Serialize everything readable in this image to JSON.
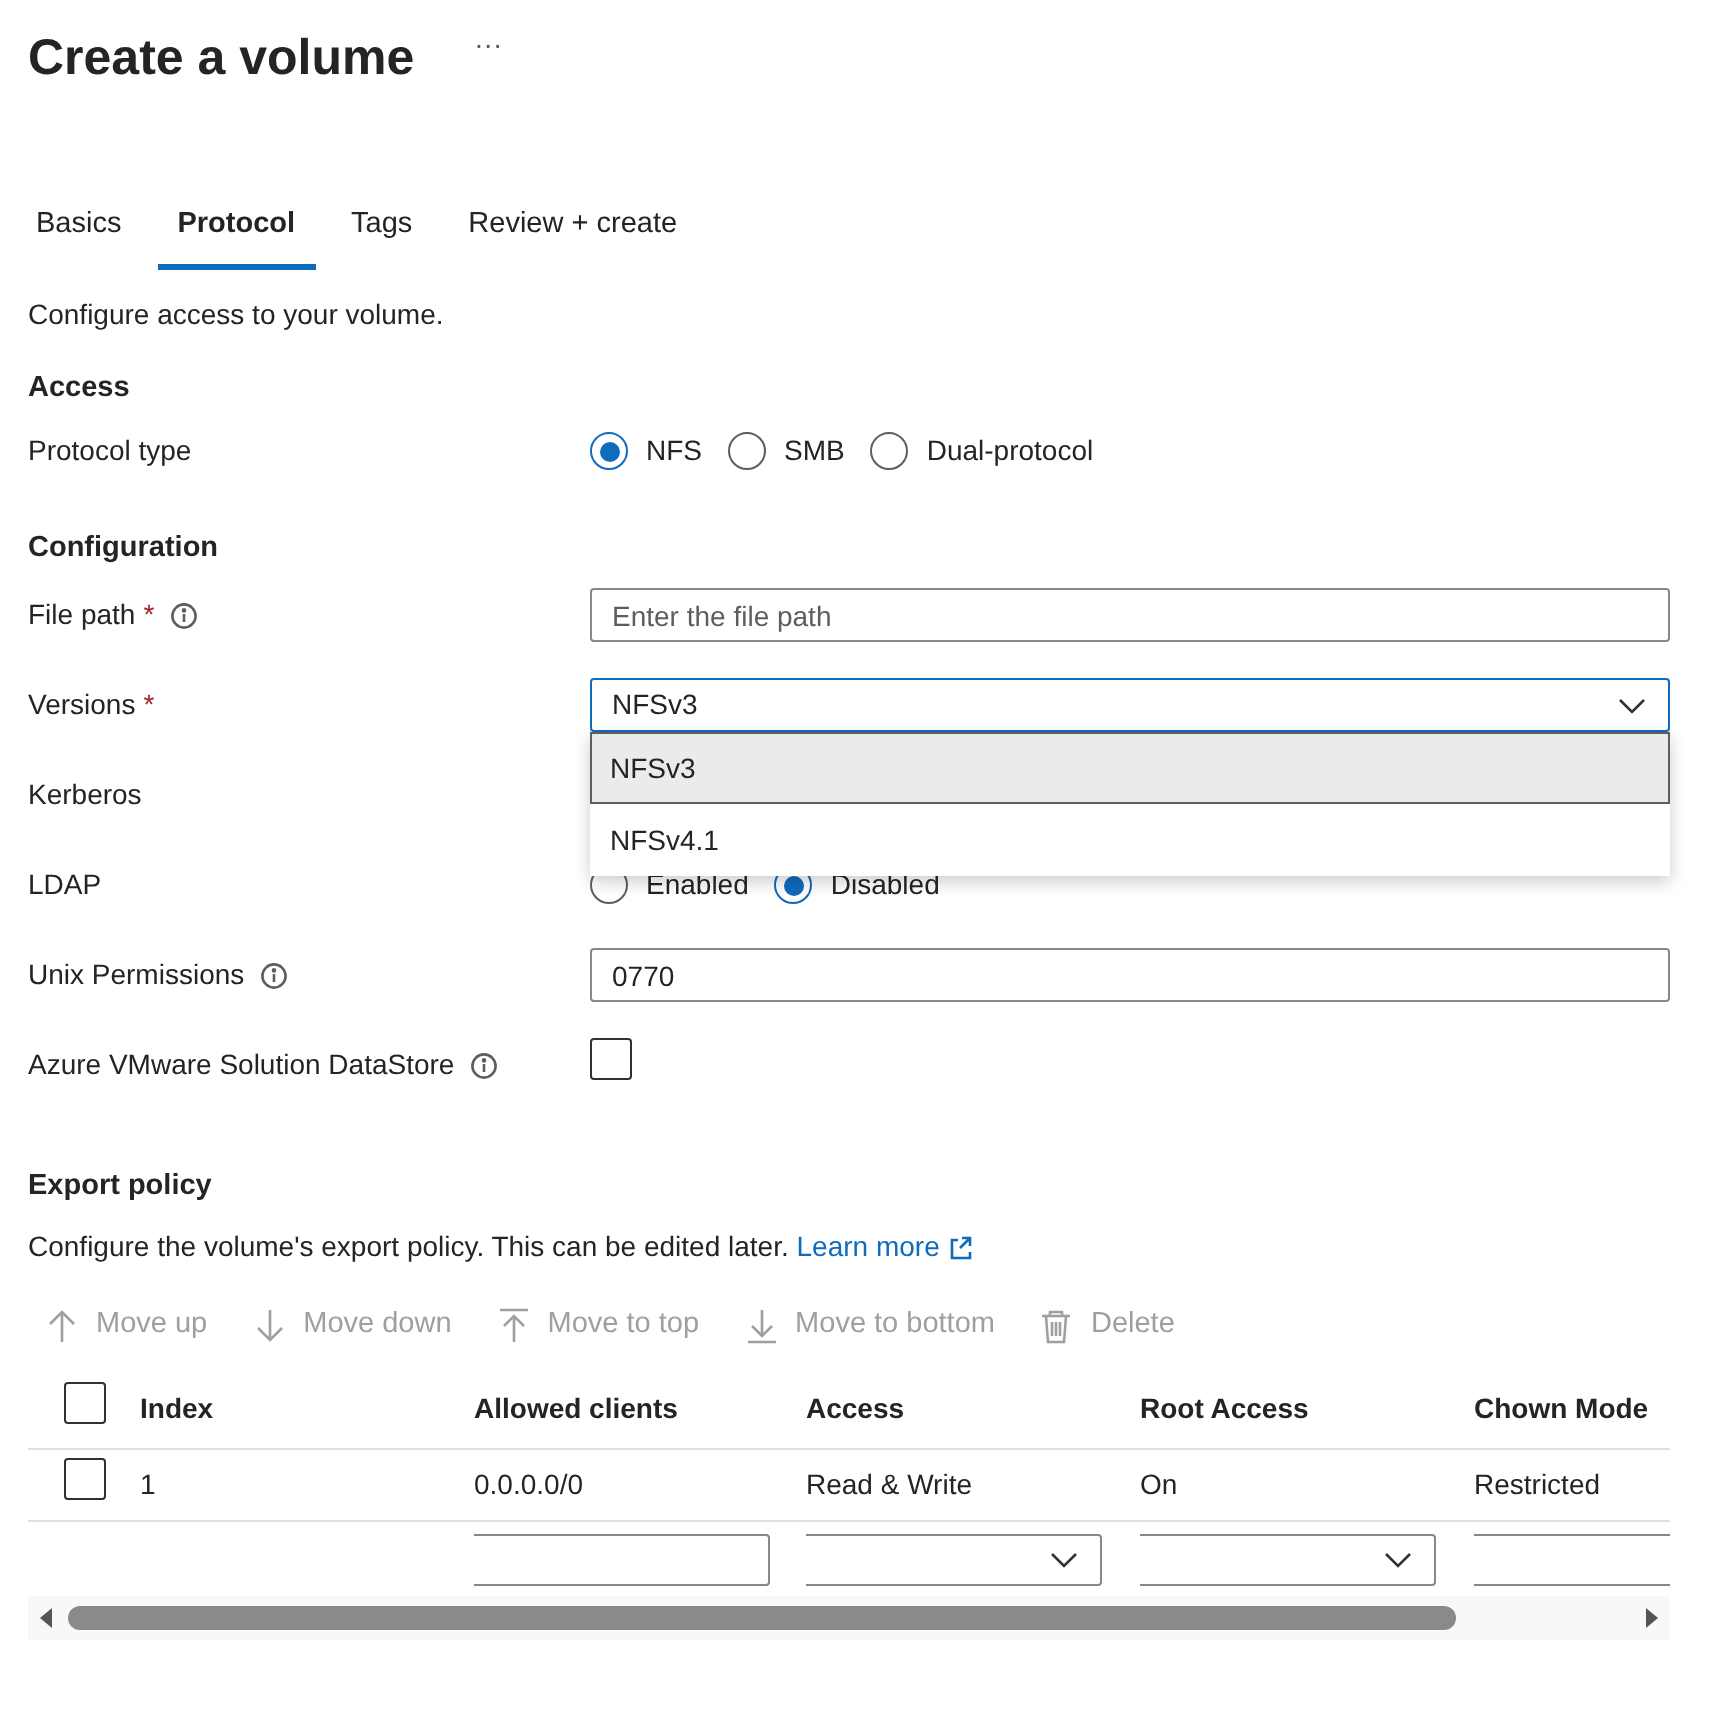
{
  "title": "Create a volume",
  "more": "···",
  "tabs": [
    {
      "label": "Basics",
      "selected": false
    },
    {
      "label": "Protocol",
      "selected": true
    },
    {
      "label": "Tags",
      "selected": false
    },
    {
      "label": "Review + create",
      "selected": false
    }
  ],
  "intro": "Configure access to your volume.",
  "access": {
    "heading": "Access",
    "label": "Protocol type",
    "options": [
      {
        "label": "NFS",
        "selected": true
      },
      {
        "label": "SMB",
        "selected": false
      },
      {
        "label": "Dual-protocol",
        "selected": false
      }
    ]
  },
  "configuration": {
    "heading": "Configuration",
    "fields": [
      {
        "kind": "text",
        "label": "File path",
        "required_mark": "*",
        "info": true,
        "placeholder": "Enter the file path"
      },
      {
        "kind": "select",
        "label": "Versions",
        "required_mark": "*",
        "value": "NFSv3",
        "expanded": true,
        "options": [
          {
            "label": "NFSv3",
            "selected": true
          },
          {
            "label": "NFSv4.1",
            "selected": false
          }
        ]
      },
      {
        "kind": "covered",
        "label": "Kerberos"
      },
      {
        "kind": "radio",
        "label": "LDAP",
        "options": [
          {
            "label": "Enabled",
            "selected": false
          },
          {
            "label": "Disabled",
            "selected": true
          }
        ]
      },
      {
        "kind": "text",
        "label": "Unix Permissions",
        "info": true,
        "value": "0770"
      },
      {
        "kind": "checkbox",
        "label": "Azure VMware Solution DataStore",
        "info": true,
        "checked": false
      }
    ]
  },
  "export_policy": {
    "heading": "Export policy",
    "description": "Configure the volume's export policy. This can be edited later.",
    "link": "Learn more",
    "toolbar": [
      {
        "kind": "up",
        "label": "Move up",
        "disabled": true
      },
      {
        "kind": "down",
        "label": "Move down",
        "disabled": true
      },
      {
        "kind": "top",
        "label": "Move to top",
        "disabled": true
      },
      {
        "kind": "bottom",
        "label": "Move to bottom",
        "disabled": true
      },
      {
        "kind": "delete",
        "label": "Delete",
        "disabled": true
      }
    ],
    "table": {
      "select_all_checked": false,
      "columns": [
        "Index",
        "Allowed clients",
        "Access",
        "Root Access",
        "Chown Mode"
      ],
      "rows": [
        {
          "checked": false,
          "cells": [
            "1",
            "0.0.0.0/0",
            "Read & Write",
            "On",
            "Restricted"
          ]
        }
      ],
      "filter_row": [
        {
          "kind": "text"
        },
        {
          "kind": "select"
        },
        {
          "kind": "select"
        },
        {
          "kind": "text"
        }
      ]
    }
  }
}
